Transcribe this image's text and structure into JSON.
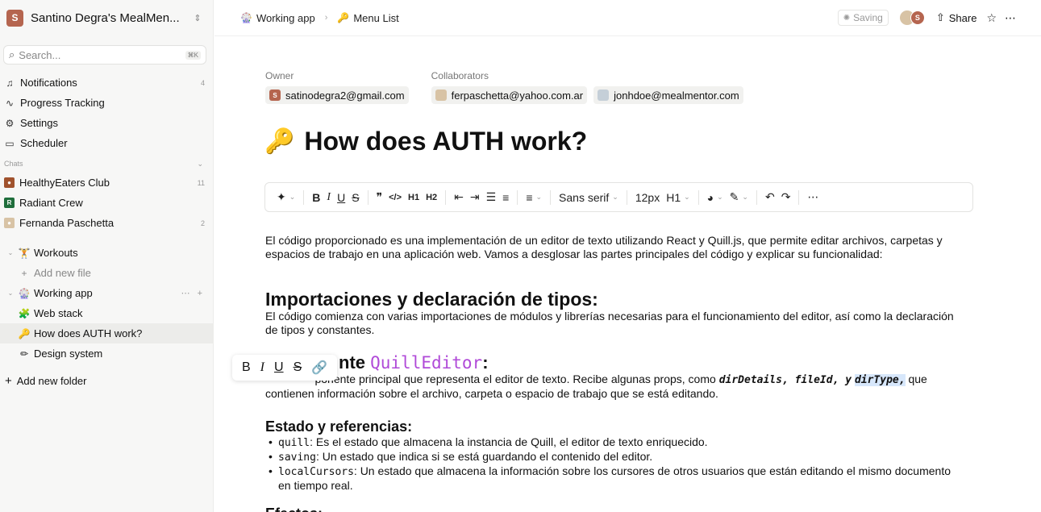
{
  "workspace": {
    "initial": "S",
    "name": "Santino Degra's MealMen...",
    "toggle_icon": "chevron-up-down-icon"
  },
  "search": {
    "placeholder": "Search...",
    "shortcut": "⌘K"
  },
  "nav": [
    {
      "label": "Notifications",
      "icon": "bell-icon",
      "count": "4"
    },
    {
      "label": "Progress Tracking",
      "icon": "activity-icon",
      "count": ""
    },
    {
      "label": "Settings",
      "icon": "gear-icon",
      "count": ""
    },
    {
      "label": "Scheduler",
      "icon": "calendar-icon",
      "count": ""
    }
  ],
  "chats": {
    "label": "Chats",
    "items": [
      {
        "label": "HealthyEaters Club",
        "badge": "",
        "count": "11"
      },
      {
        "label": "Radiant Crew",
        "badge": "R",
        "count": ""
      },
      {
        "label": "Fernanda Paschetta",
        "badge": "",
        "count": "2"
      }
    ]
  },
  "folders": {
    "workouts": "Workouts",
    "add_file": "Add new file",
    "working_app": "Working app",
    "web_stack": "Web stack",
    "auth": "How does AUTH work?",
    "design": "Design system",
    "add_folder": "Add new folder"
  },
  "breadcrumb": {
    "first": "Working app",
    "second": "Menu List"
  },
  "topbar": {
    "saving": "Saving",
    "avatar_initial": "S",
    "share": "Share"
  },
  "people": {
    "owner_label": "Owner",
    "owner": {
      "initial": "S",
      "email": "satinodegra2@gmail.com"
    },
    "collab_label": "Collaborators",
    "collaborators": [
      "ferpaschetta@yahoo.com.ar",
      "jonhdoe@mealmentor.com"
    ]
  },
  "doc": {
    "title": "How does AUTH work?",
    "p1": "El código proporcionado es una implementación de un editor de texto utilizando React y Quill.js, que permite editar archivos, carpetas y espacios de trabajo en una aplicación web. Vamos a desglosar las partes principales del código y explicar su funcionalidad:",
    "h_imports": "Importaciones y declaración de tipos:",
    "p2": "El código comienza con varias importaciones de módulos y librerías necesarias para el funcionamiento del editor, así como la declaración de tipos y constantes.",
    "h_comp_text": "nte",
    "h_comp_code": "QuillEditor",
    "h_comp_colon": ":",
    "p3_a": "ponente principal que representa el editor de texto. Recibe algunas props, como",
    "p3_props": "dirDetails, fileId, y",
    "p3_dir": "dirType,",
    "p3_b": "que contienen información sobre el archivo, carpeta o espacio de trabajo que se está editando.",
    "h_state": "Estado y referencias:",
    "state_items": [
      {
        "code": "quill",
        "text": ": Es el estado que almacena la instancia de Quill, el editor de texto enriquecido."
      },
      {
        "code": "saving",
        "text": ": Un estado que indica si se está guardando el contenido del editor."
      },
      {
        "code": "localCursors",
        "text": ": Un estado que almacena la información sobre los cursores de otros usuarios que están editando el mismo documento en tiempo real."
      }
    ],
    "h_effects": "Efectos:"
  },
  "toolbar": {
    "font": "Sans serif",
    "size": "12px",
    "heading": "H1",
    "bold": "B",
    "italic": "I",
    "underline": "U",
    "strike": "S",
    "h1": "H1",
    "h2": "H2"
  },
  "float_toolbar": {
    "bold": "B",
    "italic": "I",
    "underline": "U",
    "strike": "S"
  }
}
